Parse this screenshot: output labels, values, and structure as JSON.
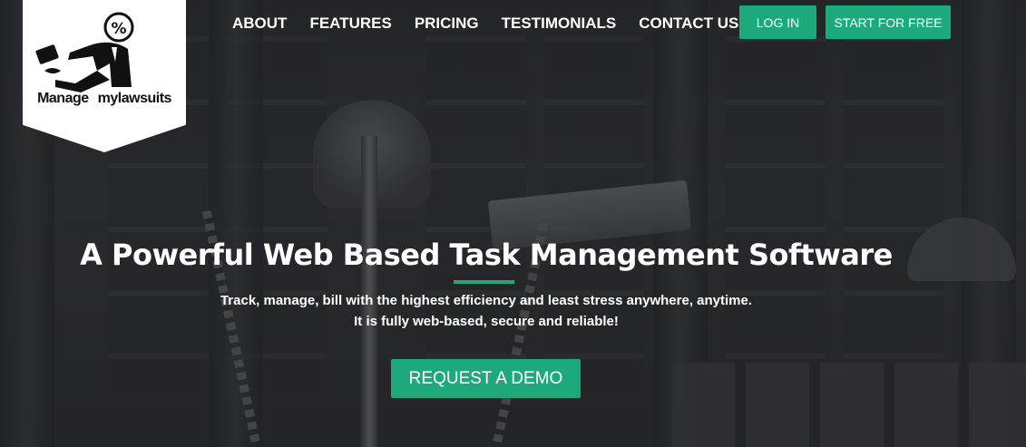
{
  "logo": {
    "text_left": "Manage",
    "text_right": "mylawsuits",
    "symbol": "%"
  },
  "nav": {
    "items": [
      "ABOUT",
      "FEATURES",
      "PRICING",
      "TESTIMONIALS",
      "CONTACT US"
    ]
  },
  "buttons": {
    "login": "LOG IN",
    "start": "START FOR FREE",
    "demo": "REQUEST A DEMO"
  },
  "hero": {
    "headline_before": "A Powerful Web Based ",
    "headline_bold": "Task",
    "headline_after": " Management Software",
    "sub_line1": "Track, manage, bill with the highest efficiency and least stress anywhere, anytime.",
    "sub_line2": "It is fully web-based, secure and reliable!"
  },
  "colors": {
    "accent": "#1ea97c",
    "background": "#2a2b2f",
    "text": "#ffffff"
  },
  "icons": [
    "mascot-logo-icon"
  ]
}
